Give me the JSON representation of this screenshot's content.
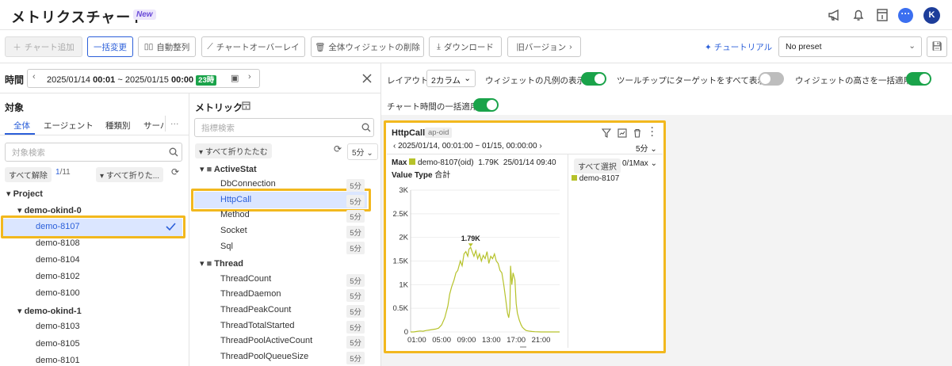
{
  "header": {
    "title": "メトリクスチャート",
    "new_badge": "New",
    "avatar": "K"
  },
  "toolbar": {
    "add_chart": "チャート追加",
    "bulk_change": "一括変更",
    "auto_arrange": "自動整列",
    "chart_overlay": "チャートオーバーレイ",
    "delete_all": "全体ウィジェットの削除",
    "download": "ダウンロード",
    "old_version": "旧バージョン",
    "tutorial": "チュートリアル",
    "preset": "No preset"
  },
  "time": {
    "label": "時間",
    "start_date": "2025/01/14",
    "start_time": "00:01",
    "sep": "~",
    "end_date": "2025/01/15",
    "end_time": "00:00",
    "duration": "23時"
  },
  "target": {
    "title": "対象",
    "tabs": [
      "全体",
      "エージェント",
      "種類別",
      "サーバ"
    ],
    "more": "···",
    "search_placeholder": "対象検索",
    "clear_all": "すべて解除",
    "count": "1",
    "total": "/11",
    "collapse_all": "すべて折りた...",
    "project": "Project",
    "groups": [
      {
        "name": "demo-okind-0",
        "items": [
          "demo-8107",
          "demo-8108",
          "demo-8104",
          "demo-8102",
          "demo-8100"
        ]
      },
      {
        "name": "demo-okind-1",
        "items": [
          "demo-8103",
          "demo-8105",
          "demo-8101"
        ]
      }
    ]
  },
  "metric": {
    "title": "メトリック",
    "search_placeholder": "指標検索",
    "collapse_all": "すべて折りたたむ",
    "interval": "5分",
    "folders": [
      {
        "name": "ActiveStat",
        "items": [
          {
            "name": "DbConnection",
            "iv": "5分"
          },
          {
            "name": "HttpCall",
            "iv": "5分"
          },
          {
            "name": "Method",
            "iv": "5分"
          },
          {
            "name": "Socket",
            "iv": "5分"
          },
          {
            "name": "Sql",
            "iv": "5分"
          }
        ]
      },
      {
        "name": "Thread",
        "items": [
          {
            "name": "ThreadCount",
            "iv": "5分"
          },
          {
            "name": "ThreadDaemon",
            "iv": "5分"
          },
          {
            "name": "ThreadPeakCount",
            "iv": "5分"
          },
          {
            "name": "ThreadTotalStarted",
            "iv": "5分"
          },
          {
            "name": "ThreadPoolActiveCount",
            "iv": "5分"
          },
          {
            "name": "ThreadPoolQueueSize",
            "iv": "5分"
          }
        ]
      }
    ]
  },
  "settings": {
    "layout_label": "レイアウト",
    "layout_value": "2カラム",
    "legend_label": "ウィジェットの凡例の表示",
    "tooltip_label": "ツールチップにターゲットをすべて表示",
    "height_label": "ウィジェットの高さを一括適用",
    "time_label": "チャート時間の一括適用",
    "legend_on": true,
    "tooltip_on": false,
    "height_on": true,
    "time_on": true
  },
  "widget": {
    "title": "HttpCall",
    "tag": "ap-oid",
    "range": "2025/01/14, 00:01:00 ~ 01/15, 00:00:00",
    "interval": "5分",
    "max_label": "Max",
    "max_series": "demo-8107(oid)",
    "max_value": "1.79K",
    "max_time": "25/01/14 09:40",
    "value_type_label": "Value Type",
    "value_type": "合計",
    "select_all": "すべて選択",
    "max_count": "0/1Max",
    "legend_item": "demo-8107",
    "peak_label": "1.79K"
  },
  "chart_data": {
    "type": "line",
    "title": "",
    "xlabel": "",
    "ylabel": "",
    "ylim": [
      0,
      3000
    ],
    "xlim": [
      0,
      24
    ],
    "y_ticks": [
      "0",
      "0.5K",
      "1K",
      "1.5K",
      "2K",
      "2.5K",
      "3K"
    ],
    "x_ticks": [
      "01:00",
      "05:00",
      "09:00",
      "13:00",
      "17:00",
      "21:00"
    ],
    "series": [
      {
        "name": "demo-8107",
        "color": "#b6c22a",
        "x": [
          0,
          0.5,
          1,
          1.5,
          2,
          2.5,
          3,
          3.5,
          4,
          4.5,
          5,
          5.5,
          6,
          6.3,
          6.6,
          7,
          7.3,
          7.6,
          8,
          8.3,
          8.6,
          8.9,
          9.2,
          9.4,
          9.67,
          9.9,
          10.2,
          10.5,
          10.8,
          11.1,
          11.4,
          11.7,
          12,
          12.3,
          12.6,
          12.9,
          13.2,
          13.5,
          13.8,
          14.1,
          14.4,
          14.7,
          15,
          15.3,
          15.6,
          15.8,
          16,
          16.1,
          16.3,
          16.5,
          16.8,
          17,
          17.2,
          17.5,
          17.8,
          18,
          18.3,
          18.6,
          19,
          19.5,
          20,
          21,
          22,
          23,
          24
        ],
        "y": [
          0,
          0,
          10,
          20,
          15,
          30,
          40,
          50,
          60,
          80,
          150,
          300,
          550,
          800,
          950,
          1100,
          1250,
          1300,
          1500,
          1400,
          1650,
          1700,
          1600,
          1750,
          1790,
          1700,
          1600,
          1720,
          1550,
          1650,
          1500,
          1620,
          1550,
          1700,
          1450,
          1600,
          1550,
          1650,
          1500,
          1450,
          1300,
          1250,
          1000,
          700,
          400,
          300,
          500,
          1400,
          1000,
          1250,
          1100,
          600,
          400,
          250,
          150,
          100,
          60,
          30,
          20,
          10,
          5,
          0,
          0,
          0,
          0
        ]
      }
    ]
  }
}
